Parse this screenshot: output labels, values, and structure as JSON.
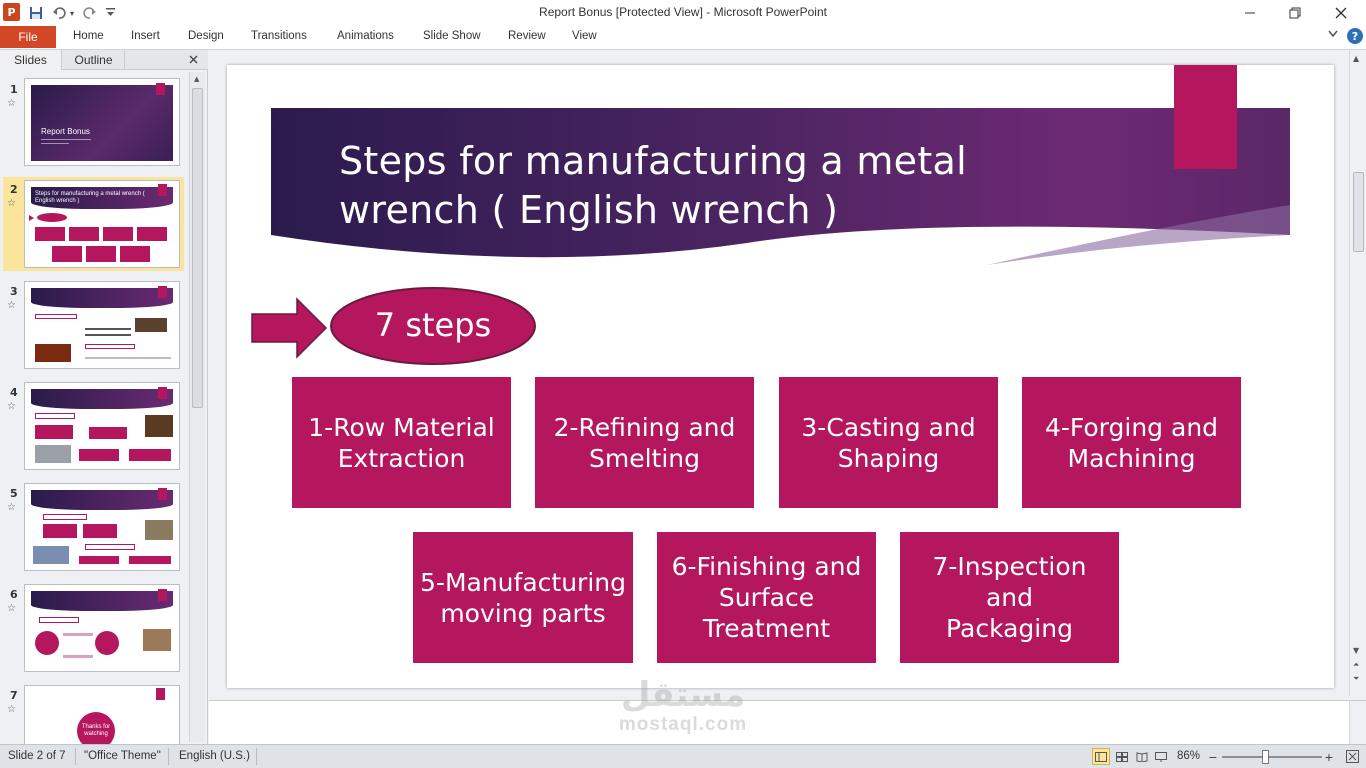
{
  "window": {
    "title": "Report Bonus [Protected View]  -  Microsoft PowerPoint",
    "app_icon": "P",
    "minimize": "—",
    "restore": "❐",
    "close": "✕"
  },
  "quick_access": {
    "save": "💾",
    "undo": "↶",
    "redo": "↻",
    "customize": "▾"
  },
  "ribbon": {
    "file": "File",
    "tabs": [
      "Home",
      "Insert",
      "Design",
      "Transitions",
      "Animations",
      "Slide Show",
      "Review",
      "View"
    ],
    "minimize_icon": "chevron-down-icon",
    "help": "?"
  },
  "left_pane": {
    "tabs": [
      "Slides",
      "Outline"
    ],
    "close": "✕",
    "slides": [
      {
        "num": "1",
        "title": "Report Bonus"
      },
      {
        "num": "2",
        "title": "Steps for manufacturing a metal wrench ( English wrench )",
        "selected": true
      },
      {
        "num": "3"
      },
      {
        "num": "4"
      },
      {
        "num": "5"
      },
      {
        "num": "6"
      },
      {
        "num": "7",
        "title": "Thanks for watching"
      }
    ]
  },
  "slide": {
    "title": "Steps for manufacturing a metal wrench ( English wrench )",
    "title_line1": "Steps for manufacturing a metal",
    "title_line2": "wrench ( English wrench )",
    "oval": "7 steps",
    "steps": [
      "1-Row Material Extraction",
      "2-Refining and Smelting",
      "3-Casting and Shaping",
      "4-Forging and Machining",
      "5-Manufacturing moving parts",
      "6-Finishing and Surface Treatment",
      "7-Inspection and Packaging"
    ],
    "colors": {
      "accent": "#b5175f",
      "band_dark": "#2a1b4a",
      "band_mid": "#6a2a72"
    }
  },
  "watermark": {
    "arabic": "مستقل",
    "latin": "mostaql.com"
  },
  "status": {
    "slide_info": "Slide 2 of 7",
    "theme": "\"Office Theme\"",
    "language": "English (U.S.)",
    "zoom": "86%",
    "zoom_out": "−",
    "zoom_in": "+"
  }
}
